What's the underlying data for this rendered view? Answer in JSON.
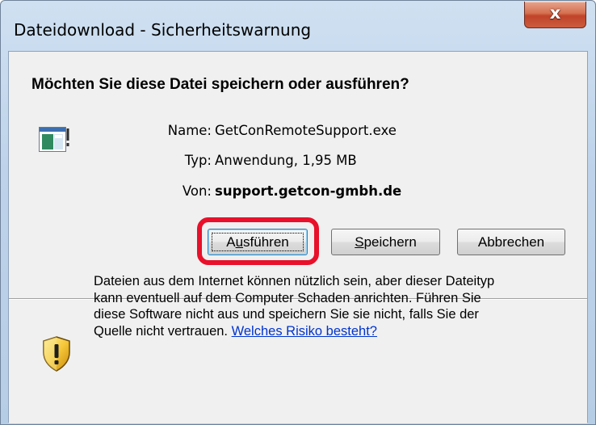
{
  "window": {
    "title": "Dateidownload - Sicherheitswarnung",
    "close_glyph": "x"
  },
  "question": "Möchten Sie diese Datei speichern oder ausführen?",
  "file_icon": "application-window-icon",
  "info": {
    "name_label": "Name:",
    "name_value": "GetConRemoteSupport.exe",
    "type_label": "Typ:",
    "type_value": "Anwendung, 1,95 MB",
    "from_label": "Von:",
    "from_value": "support.getcon-gmbh.de"
  },
  "buttons": {
    "run_prefix": "A",
    "run_underlined": "u",
    "run_rest": "sführen",
    "save_underlined": "S",
    "save_rest": "peichern",
    "cancel": "Abbrechen"
  },
  "highlight_color": "#e8102a",
  "warning": {
    "icon": "security-shield-warning-icon",
    "line1": "Dateien aus dem Internet können nützlich sein, aber dieser Dateityp",
    "line2": "kann eventuell auf dem Computer Schaden anrichten. Führen Sie",
    "line3": "diese Software nicht aus und speichern Sie sie nicht, falls Sie der",
    "line4": "Quelle nicht vertrauen.",
    "link": "Welches Risiko besteht?"
  }
}
